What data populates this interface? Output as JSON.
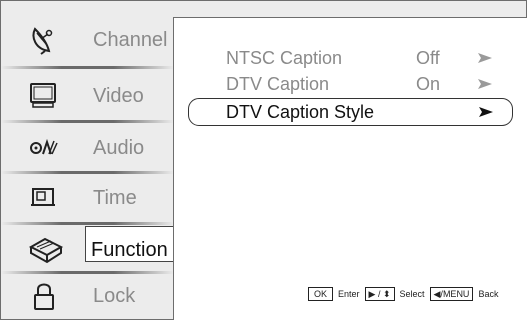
{
  "sidebar": {
    "items": [
      {
        "label": "Channel",
        "icon": "satellite-dish-icon"
      },
      {
        "label": "Video",
        "icon": "monitor-icon"
      },
      {
        "label": "Audio",
        "icon": "audio-icon"
      },
      {
        "label": "Time",
        "icon": "clock-icon"
      },
      {
        "label": "Function",
        "icon": "toolbox-icon",
        "active": true
      },
      {
        "label": "Lock",
        "icon": "padlock-icon"
      }
    ]
  },
  "options": [
    {
      "name": "NTSC Caption",
      "value": "Off"
    },
    {
      "name": "DTV Caption",
      "value": "On"
    },
    {
      "name": "DTV Caption Style",
      "value": "",
      "selected": true
    }
  ],
  "help": {
    "ok_key": "OK",
    "enter_text": "Enter",
    "nav_key": "▶ / ⬍",
    "select_text": "Select",
    "back_key": "◀/MENU",
    "back_text": "Back"
  },
  "colors": {
    "sidebar_bg": "#ececec",
    "text_inactive": "#8a8a8a",
    "text_active": "#111111"
  }
}
